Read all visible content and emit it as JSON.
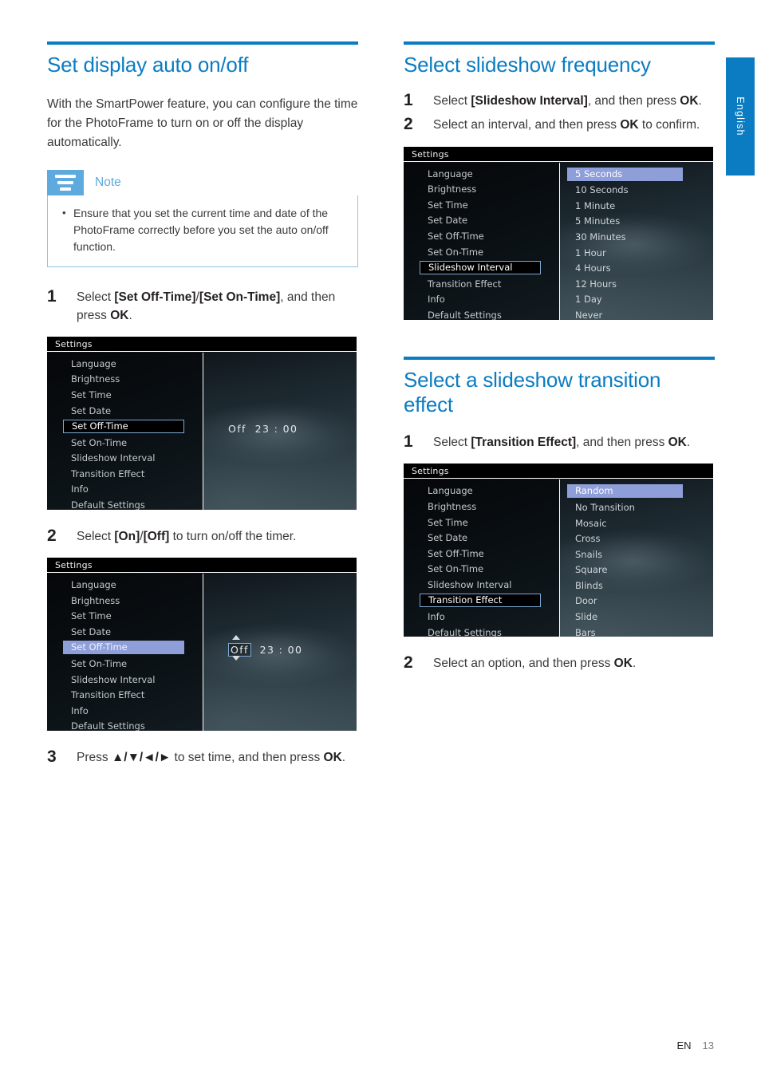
{
  "language_tab": {
    "label": "English"
  },
  "footer": {
    "lang_code": "EN",
    "page_number": "13"
  },
  "left_column": {
    "heading": "Set display auto on/off",
    "intro": "With the SmartPower feature, you can configure the time for the PhotoFrame to turn on or off the display automatically.",
    "note": {
      "title": "Note",
      "bullet": "Ensure that you set the current time and date of the PhotoFrame correctly before you set the auto on/off function."
    },
    "step1": {
      "number": "1",
      "text_a": "Select ",
      "bold_a": "[Set Off-Time]",
      "text_b": "/",
      "bold_b": "[Set On-Time]",
      "text_c": ", and then press ",
      "bold_c": "OK",
      "text_d": "."
    },
    "screenshot1": {
      "titlebar": "Settings",
      "menu": [
        "Language",
        "Brightness",
        "Set Time",
        "Set Date",
        "Set Off-Time",
        "Set On-Time",
        "Slideshow Interval",
        "Transition Effect",
        "Info",
        "Default Settings"
      ],
      "selected_index": 4,
      "selection_style": "box",
      "value_label": "Off",
      "value_time": "23 : 00"
    },
    "step2": {
      "number": "2",
      "text_a": "Select ",
      "bold_a": "[On]",
      "text_b": "/",
      "bold_b": "[Off]",
      "text_c": " to turn on/off the timer."
    },
    "screenshot2": {
      "titlebar": "Settings",
      "menu": [
        "Language",
        "Brightness",
        "Set Time",
        "Set Date",
        "Set Off-Time",
        "Set On-Time",
        "Slideshow Interval",
        "Transition Effect",
        "Info",
        "Default Settings"
      ],
      "selected_index": 4,
      "selection_style": "fill",
      "value_label": "Off",
      "value_time": "23 : 00"
    },
    "step3": {
      "number": "3",
      "text_a": "Press ",
      "keys": "▲/▼/◄/►",
      "text_b": " to set time, and then press ",
      "bold_b": "OK",
      "text_c": "."
    }
  },
  "right_column": {
    "section1": {
      "heading": "Select slideshow frequency",
      "step1": {
        "number": "1",
        "text_a": "Select ",
        "bold_a": "[Slideshow Interval]",
        "text_b": ", and then press ",
        "bold_b": "OK",
        "text_c": "."
      },
      "step2": {
        "number": "2",
        "text_a": "Select an interval, and then press ",
        "bold_a": "OK",
        "text_b": " to confirm."
      },
      "screenshot": {
        "titlebar": "Settings",
        "menu": [
          "Language",
          "Brightness",
          "Set Time",
          "Set Date",
          "Set Off-Time",
          "Set On-Time",
          "Slideshow Interval",
          "Transition Effect",
          "Info",
          "Default Settings"
        ],
        "selected_index": 6,
        "selection_style": "box",
        "options": [
          "5 Seconds",
          "10 Seconds",
          "1 Minute",
          "5 Minutes",
          "30 Minutes",
          "1 Hour",
          "4 Hours",
          "12 Hours",
          "1 Day",
          "Never"
        ],
        "option_selected_index": 0
      }
    },
    "section2": {
      "heading": "Select a slideshow transition effect",
      "step1": {
        "number": "1",
        "text_a": "Select ",
        "bold_a": "[Transition Effect]",
        "text_b": ", and then press ",
        "bold_b": "OK",
        "text_c": "."
      },
      "screenshot": {
        "titlebar": "Settings",
        "menu": [
          "Language",
          "Brightness",
          "Set Time",
          "Set Date",
          "Set Off-Time",
          "Set On-Time",
          "Slideshow Interval",
          "Transition Effect",
          "Info",
          "Default Settings"
        ],
        "selected_index": 7,
        "selection_style": "box",
        "options": [
          "Random",
          "No Transition",
          "Mosaic",
          "Cross",
          "Snails",
          "Square",
          "Blinds",
          "Door",
          "Slide",
          "Bars"
        ],
        "option_selected_index": 0
      },
      "step2": {
        "number": "2",
        "text_a": "Select an option, and then press ",
        "bold_a": "OK",
        "text_b": "."
      }
    }
  },
  "colors": {
    "accent_blue": "#0b7cc1",
    "note_blue": "#5ea9dd",
    "menu_highlight": "#8e9ed8",
    "selection_border": "#7ea9d8"
  }
}
